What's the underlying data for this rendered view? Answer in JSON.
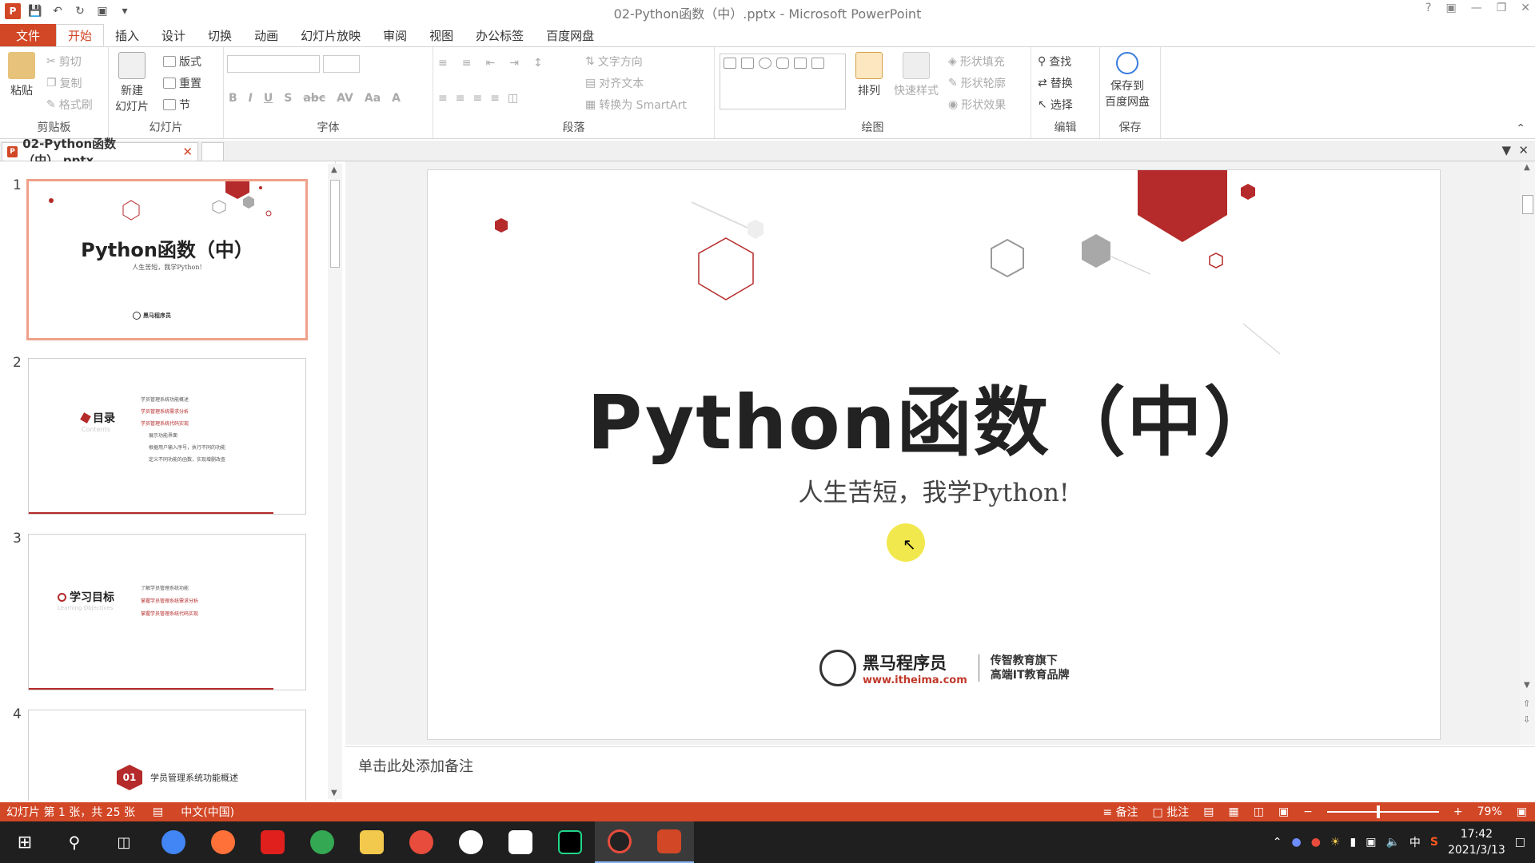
{
  "window": {
    "title": "02-Python函数（中）.pptx - Microsoft PowerPoint",
    "app_logo": "P"
  },
  "menu": {
    "tabs": [
      "文件",
      "开始",
      "插入",
      "设计",
      "切换",
      "动画",
      "幻灯片放映",
      "审阅",
      "视图",
      "办公标签",
      "百度网盘"
    ],
    "active": "开始"
  },
  "ribbon": {
    "clipboard": {
      "label": "剪贴板",
      "paste": "粘贴",
      "cut": "剪切",
      "copy": "复制",
      "format_painter": "格式刷"
    },
    "slides": {
      "label": "幻灯片",
      "new_slide": "新建\n幻灯片",
      "layout": "版式",
      "reset": "重置",
      "section": "节"
    },
    "font": {
      "label": "字体"
    },
    "paragraph": {
      "label": "段落",
      "text_direction": "文字方向",
      "align_text": "对齐文本",
      "smartart": "转换为 SmartArt"
    },
    "drawing": {
      "label": "绘图",
      "arrange": "排列",
      "quick_styles": "快速样式",
      "shape_fill": "形状填充",
      "shape_outline": "形状轮廓",
      "shape_effects": "形状效果"
    },
    "editing": {
      "label": "编辑",
      "find": "查找",
      "replace": "替换",
      "select": "选择"
    },
    "save": {
      "label": "保存",
      "save_to_baidu": "保存到\n百度网盘"
    }
  },
  "doc_tab": {
    "name": "02-Python函数（中）.pptx"
  },
  "thumbnails": [
    {
      "num": "1",
      "title": "Python函数（中）",
      "subtitle": "人生苦短，我学Python!",
      "logo": "黑马程序员"
    },
    {
      "num": "2",
      "title": "目录",
      "en": "Contents",
      "items": [
        "学员管理系统功能概述",
        "学员管理系统需求分析",
        "学员管理系统代码实现",
        "展示功能界面",
        "根据用户输入序号，执行不同的功能",
        "定义不同功能的函数，实现增删改查"
      ]
    },
    {
      "num": "3",
      "title": "学习目标",
      "en": "Learning Objectives",
      "items": [
        "了解学员管理系统功能",
        "掌握学员管理系统需求分析",
        "掌握学员管理系统代码实现"
      ]
    },
    {
      "num": "4",
      "badge": "01",
      "title": "学员管理系统功能概述"
    }
  ],
  "slide": {
    "title": "Python函数（中）",
    "subtitle": "人生苦短，我学Python!",
    "logo_name": "黑马程序员",
    "logo_url": "www.itheima.com",
    "logo_tag1": "传智教育旗下",
    "logo_tag2": "高端IT教育品牌"
  },
  "notes": {
    "placeholder": "单击此处添加备注"
  },
  "status": {
    "slide_info": "幻灯片 第 1 张，共 25 张",
    "language": "中文(中国)",
    "notes_btn": "备注",
    "comments_btn": "批注",
    "zoom": "79%"
  },
  "taskbar": {
    "time": "17:42",
    "date": "2021/3/13",
    "ime": "中"
  },
  "colors": {
    "accent": "#d24726",
    "hex_red": "#b52a2a",
    "hex_gray": "#a8a8a8"
  }
}
